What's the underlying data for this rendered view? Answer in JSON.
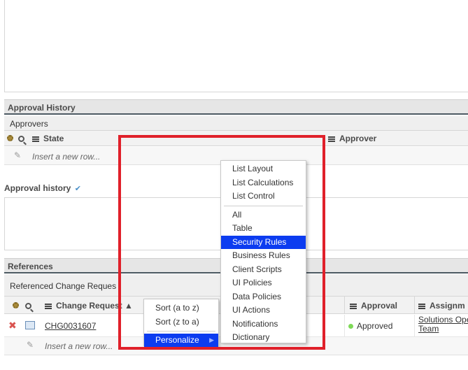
{
  "approval_history": {
    "section_title": "Approval History",
    "tab": "Approvers",
    "columns": {
      "state": "State",
      "approver": "Approver"
    },
    "insert_row": "Insert a new row...",
    "history_label": "Approval history"
  },
  "references": {
    "section_title": "References",
    "tab": "Referenced Change Reques",
    "columns": {
      "change_request": "Change Request ▲",
      "approval": "Approval",
      "assignment": "Assignm"
    },
    "row": {
      "number": "CHG0031607",
      "approval": "Approved",
      "assignment_line1": "Solutions Ope",
      "assignment_line2": "Team"
    },
    "insert_row": "Insert a new row..."
  },
  "sort_menu": {
    "items": [
      "Sort (a to z)",
      "Sort (z to a)"
    ],
    "personalize": "Personalize"
  },
  "personalize_menu": {
    "group1": [
      "List Layout",
      "List Calculations",
      "List Control"
    ],
    "group2": [
      "All",
      "Table",
      "Security Rules",
      "Business Rules",
      "Client Scripts",
      "UI Policies",
      "Data Policies",
      "UI Actions",
      "Notifications",
      "Dictionary"
    ],
    "selected": "Security Rules"
  },
  "colors": {
    "highlight": "#0c3cf0",
    "annotation_red": "#e0202a",
    "approved_dot": "#7ed957"
  }
}
